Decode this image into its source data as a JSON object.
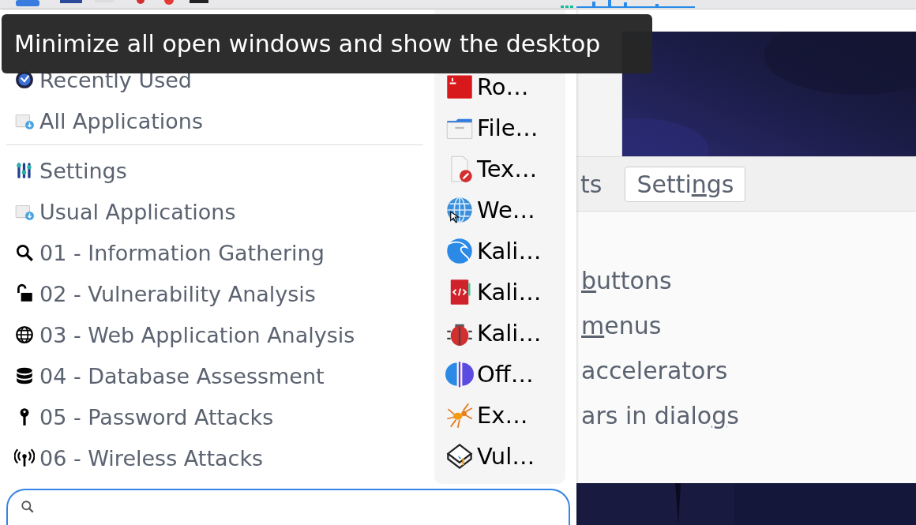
{
  "tooltip": {
    "text": "Minimize all open windows and show the desktop"
  },
  "menu": {
    "top_categories": [
      {
        "label": "Recently Used"
      },
      {
        "label": "All Applications"
      }
    ],
    "categories": [
      {
        "label": "Settings"
      },
      {
        "label": "Usual Applications"
      },
      {
        "label": "01 - Information Gathering"
      },
      {
        "label": "02 - Vulnerability Analysis"
      },
      {
        "label": "03 - Web Application Analysis"
      },
      {
        "label": "04 - Database Assessment"
      },
      {
        "label": "05 - Password Attacks"
      },
      {
        "label": "06 - Wireless Attacks"
      }
    ],
    "apps": [
      {
        "label": "Ro…"
      },
      {
        "label": "File…"
      },
      {
        "label": "Tex…"
      },
      {
        "label": "We…"
      },
      {
        "label": "Kali…"
      },
      {
        "label": "Kali…"
      },
      {
        "label": "Kali…"
      },
      {
        "label": "Off…"
      },
      {
        "label": "Ex…"
      },
      {
        "label": "Vul…"
      }
    ]
  },
  "background_window": {
    "tabs": [
      {
        "after": "ts",
        "selected": false
      },
      {
        "before": "Setti",
        "key": "n",
        "after": "gs",
        "selected": true
      }
    ],
    "options": [
      {
        "key": "b",
        "after": "uttons"
      },
      {
        "key": "m",
        "after": "enus"
      },
      {
        "before": "accelerators"
      },
      {
        "before": "ars in dialo",
        "key": "g",
        "after": "s"
      }
    ]
  }
}
